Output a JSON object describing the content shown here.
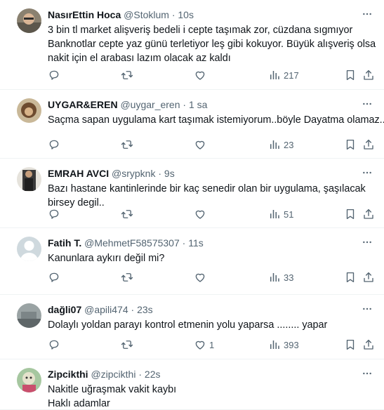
{
  "tweets": [
    {
      "name": "NasırEttin Hoca",
      "handle": "@Stoklum",
      "time": "10s",
      "lines": [
        "3 bin tl market alişveriş bedeli i cepte taşımak zor, cüzdana sıgmıyor",
        "Banknotlar cepte yaz günü terletiyor leş gibi kokuyor. Büyük alışveriş olsa",
        "nakit için el arabası lazım olacak az kaldı"
      ],
      "likes": "",
      "views": "217"
    },
    {
      "name": "UYGAR&EREN",
      "handle": "@uygar_eren",
      "time": "1 sa",
      "lines": [
        "Saçma sapan uygulama kart taşımak istemiyorum..böyle Dayatma olamaz.."
      ],
      "likes": "",
      "views": "23"
    },
    {
      "name": "EMRAH AVCI",
      "handle": "@srypknk",
      "time": "9s",
      "lines": [
        "Bazı hastane kantinlerinde bir kaç senedir olan bir uygulama, şaşılacak",
        "birsey degil.."
      ],
      "likes": "",
      "views": "51"
    },
    {
      "name": "Fatih T.",
      "handle": "@MehmetF58575307",
      "time": "11s",
      "lines": [
        "Kanunlara aykırı değil mi?"
      ],
      "likes": "",
      "views": "33"
    },
    {
      "name": "dağli07",
      "handle": "@apili474",
      "time": "23s",
      "lines": [
        "Dolaylı yoldan parayı kontrol etmenin yolu yaparsa ........ yapar"
      ],
      "likes": "1",
      "views": "393"
    },
    {
      "name": "Zipcikthi",
      "handle": "@zipcikthi",
      "time": "22s",
      "lines": [
        "Nakitle uğraşmak vakit kaybı",
        "Haklı adamlar"
      ],
      "likes": "",
      "views": ""
    }
  ],
  "icons": {
    "more": "more-dots-icon",
    "reply": "reply-icon",
    "retweet": "retweet-icon",
    "like": "like-icon",
    "views": "views-icon",
    "bookmark": "bookmark-icon",
    "share": "share-icon"
  },
  "colors": {
    "text": "#0f1419",
    "secondary": "#536471",
    "divider": "#eff3f4"
  }
}
